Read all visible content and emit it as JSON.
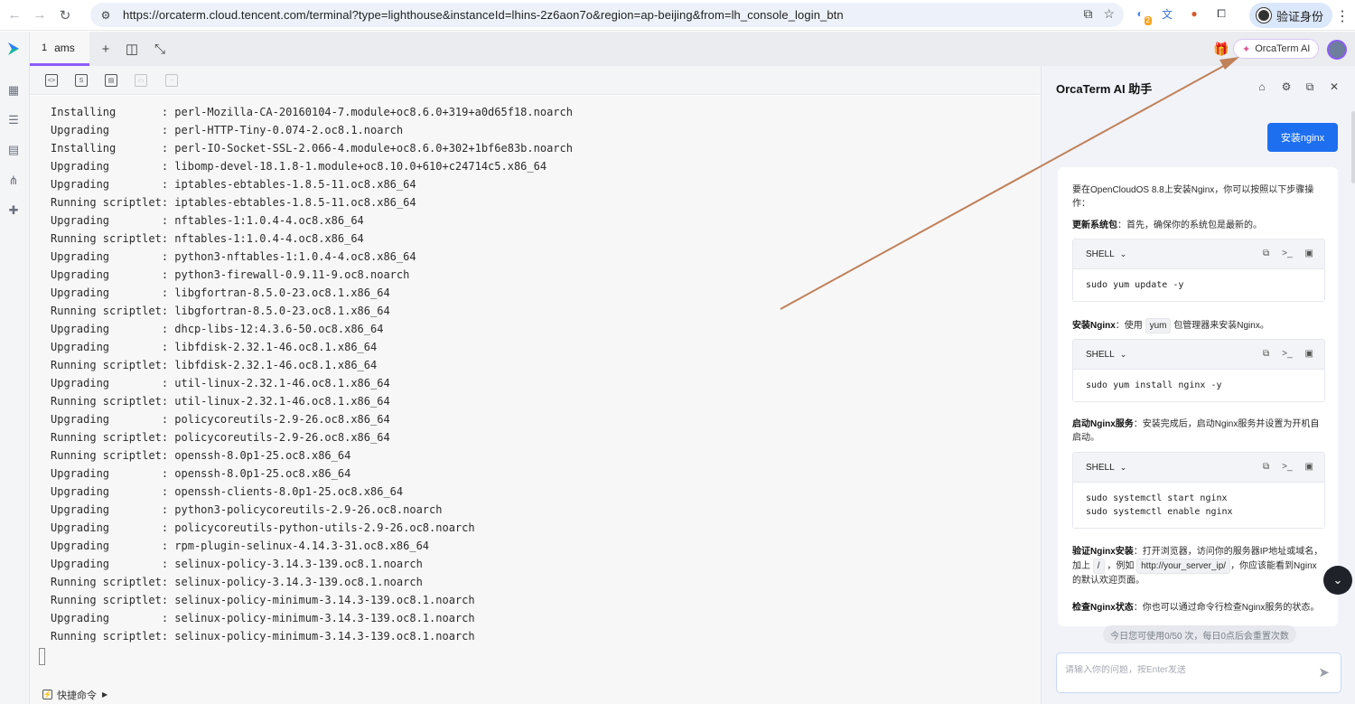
{
  "browser": {
    "url": "https://orcaterm.cloud.tencent.com/terminal?type=lighthouse&instanceId=lhins-2z6aon7o&region=ap-beijing&from=lh_console_login_btn",
    "profile_label": "验证身份",
    "extension_badge": "2"
  },
  "tabs": [
    {
      "number": "1",
      "label": "ams"
    }
  ],
  "ai_pill_label": "OrcaTerm AI",
  "terminal": {
    "lines": [
      "Installing       : perl-Mozilla-CA-20160104-7.module+oc8.6.0+319+a0d65f18.noarch",
      "Upgrading        : perl-HTTP-Tiny-0.074-2.oc8.1.noarch",
      "Installing       : perl-IO-Socket-SSL-2.066-4.module+oc8.6.0+302+1bf6e83b.noarch",
      "Upgrading        : libomp-devel-18.1.8-1.module+oc8.10.0+610+c24714c5.x86_64",
      "Upgrading        : iptables-ebtables-1.8.5-11.oc8.x86_64",
      "Running scriptlet: iptables-ebtables-1.8.5-11.oc8.x86_64",
      "Upgrading        : nftables-1:1.0.4-4.oc8.x86_64",
      "Running scriptlet: nftables-1:1.0.4-4.oc8.x86_64",
      "Upgrading        : python3-nftables-1:1.0.4-4.oc8.x86_64",
      "Upgrading        : python3-firewall-0.9.11-9.oc8.noarch",
      "Upgrading        : libgfortran-8.5.0-23.oc8.1.x86_64",
      "Running scriptlet: libgfortran-8.5.0-23.oc8.1.x86_64",
      "Upgrading        : dhcp-libs-12:4.3.6-50.oc8.x86_64",
      "Upgrading        : libfdisk-2.32.1-46.oc8.1.x86_64",
      "Running scriptlet: libfdisk-2.32.1-46.oc8.1.x86_64",
      "Upgrading        : util-linux-2.32.1-46.oc8.1.x86_64",
      "Running scriptlet: util-linux-2.32.1-46.oc8.1.x86_64",
      "Upgrading        : policycoreutils-2.9-26.oc8.x86_64",
      "Running scriptlet: policycoreutils-2.9-26.oc8.x86_64",
      "Running scriptlet: openssh-8.0p1-25.oc8.x86_64",
      "Upgrading        : openssh-8.0p1-25.oc8.x86_64",
      "Upgrading        : openssh-clients-8.0p1-25.oc8.x86_64",
      "Upgrading        : python3-policycoreutils-2.9-26.oc8.noarch",
      "Upgrading        : policycoreutils-python-utils-2.9-26.oc8.noarch",
      "Upgrading        : rpm-plugin-selinux-4.14.3-31.oc8.x86_64",
      "Upgrading        : selinux-policy-3.14.3-139.oc8.1.noarch",
      "Running scriptlet: selinux-policy-3.14.3-139.oc8.1.noarch",
      "Running scriptlet: selinux-policy-minimum-3.14.3-139.oc8.1.noarch",
      "Upgrading        : selinux-policy-minimum-3.14.3-139.oc8.1.noarch",
      "Running scriptlet: selinux-policy-minimum-3.14.3-139.oc8.1.noarch"
    ]
  },
  "quick_commands_label": "快捷命令",
  "ai_panel": {
    "title": "OrcaTerm AI 助手",
    "user_message": "安装nginx",
    "intro": "要在OpenCloudOS 8.8上安装Nginx，你可以按照以下步骤操作：",
    "step1_title": "更新系统包",
    "step1_text": "：首先，确保你的系统包是最新的。",
    "step2_title": "安装Nginx",
    "step2_text_a": "：使用",
    "step2_code": "yum",
    "step2_text_b": "包管理器来安装Nginx。",
    "step3_title": "启动Nginx服务",
    "step3_text": "：安装完成后，启动Nginx服务并设置为开机自启动。",
    "step4_title": "验证Nginx安装",
    "step4_text_a": "：打开浏览器，访问你的服务器IP地址或域名，加上",
    "step4_code_a": "/",
    "step4_text_b": "，例如",
    "step4_code_b": "http://your_server_ip/",
    "step4_text_c": "，你应该能看到Nginx的默认欢迎页面。",
    "step5_title": "检查Nginx状态",
    "step5_text": "：你也可以通过命令行检查Nginx服务的状态。",
    "shell_label": "SHELL",
    "code_blocks": [
      "sudo yum update -y",
      "sudo yum install nginx -y",
      "sudo systemctl start nginx\nsudo systemctl enable nginx"
    ],
    "quota_text": "今日您可使用0/50 次，每日0点后会重置次数",
    "input_placeholder": "请输入你的问题，按Enter发送"
  },
  "colors": {
    "accent": "#8b5cf6",
    "primary_button": "#1e6ff0",
    "annotation_arrow": "#c0805a"
  }
}
